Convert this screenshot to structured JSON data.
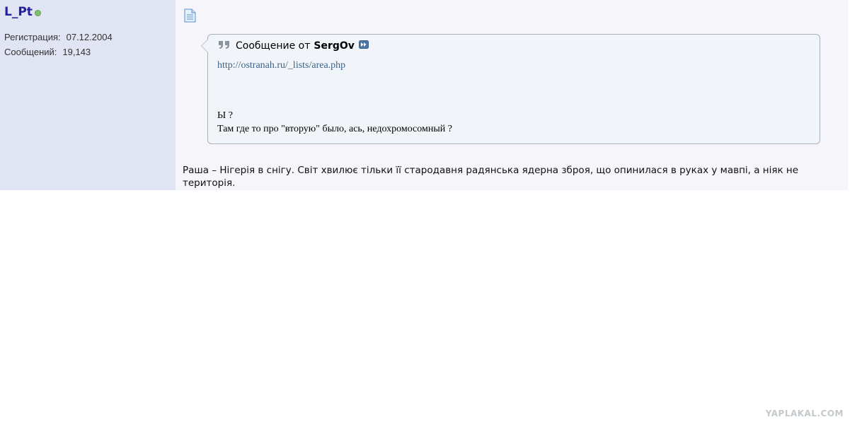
{
  "user": {
    "name": "L_Pt",
    "registration_label": "Регистрация:",
    "registration_date": "07.12.2004",
    "posts_label": "Сообщений:",
    "posts_count": "19,143"
  },
  "quote": {
    "prefix": "Сообщение от",
    "author": "SergOv",
    "link": "http://ostranah.ru/_lists/area.php",
    "line1": "Ы ?",
    "line2": "Там где то про \"вторую\" было, ась, недохромосомный ?"
  },
  "message": {
    "text": "Раша – Нігерія в снігу. Світ хвилює тільки її стародавня радянська ядерна зброя, що опинилася в руках у мавпі, а ніяк не територія."
  },
  "watermark": "YAPLAKAL.COM",
  "icons": {
    "online": "online-status-icon",
    "post": "document-icon",
    "quote": "quote-icon",
    "jump": "jump-to-post-icon"
  },
  "colors": {
    "sidebar_bg": "#e1e4f2",
    "username": "#22229c",
    "link": "#3b6287",
    "online": "#7fc06f"
  }
}
